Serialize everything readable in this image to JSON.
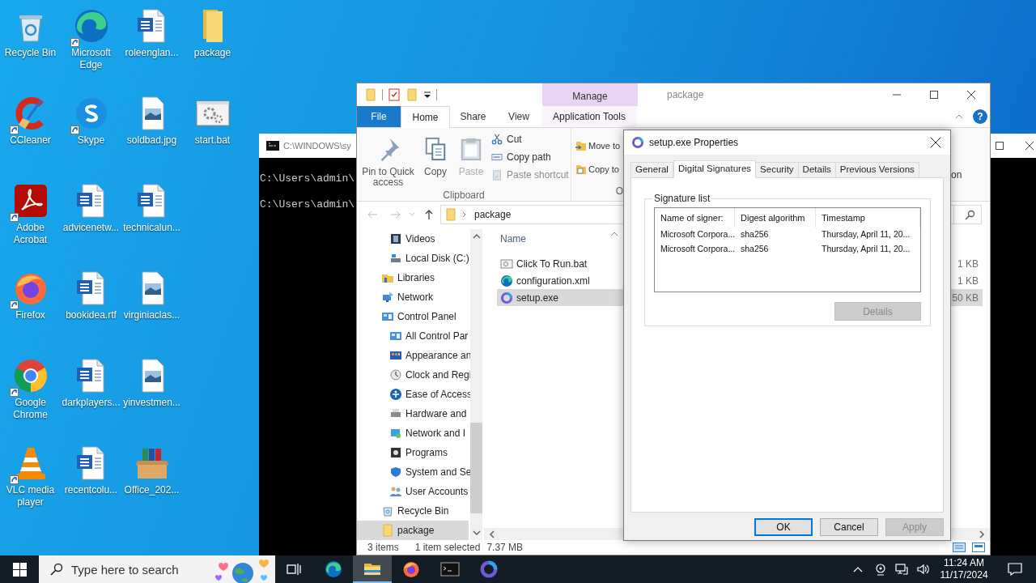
{
  "desktop_icons": [
    {
      "label": "Recycle Bin",
      "kind": "recycle",
      "shortcut": false
    },
    {
      "label": "CCleaner",
      "kind": "ccleaner",
      "shortcut": true
    },
    {
      "label": "Adobe Acrobat",
      "kind": "acrobat",
      "shortcut": true
    },
    {
      "label": "Firefox",
      "kind": "firefox",
      "shortcut": true
    },
    {
      "label": "Google Chrome",
      "kind": "chrome",
      "shortcut": true
    },
    {
      "label": "VLC media player",
      "kind": "vlc",
      "shortcut": true
    },
    {
      "label": "Microsoft Edge",
      "kind": "edge",
      "shortcut": true
    },
    {
      "label": "Skype",
      "kind": "skype",
      "shortcut": true
    },
    {
      "label": "advicenetw...",
      "kind": "word",
      "shortcut": false
    },
    {
      "label": "bookidea.rtf",
      "kind": "word",
      "shortcut": false
    },
    {
      "label": "darkplayers...",
      "kind": "word",
      "shortcut": false
    },
    {
      "label": "recentcolu...",
      "kind": "word",
      "shortcut": false
    },
    {
      "label": "roleenglan...",
      "kind": "word",
      "shortcut": false
    },
    {
      "label": "soldbad.jpg",
      "kind": "image",
      "shortcut": false
    },
    {
      "label": "technicalun...",
      "kind": "word",
      "shortcut": false
    },
    {
      "label": "virginiaclas...",
      "kind": "image",
      "shortcut": false
    },
    {
      "label": "yinvestmen...",
      "kind": "image",
      "shortcut": false
    },
    {
      "label": "Office_202...",
      "kind": "archive",
      "shortcut": false
    },
    {
      "label": "package",
      "kind": "folder",
      "shortcut": false
    },
    {
      "label": "start.bat",
      "kind": "bat",
      "shortcut": false
    }
  ],
  "console": {
    "title": "C:\\WINDOWS\\sy",
    "lines": [
      "C:\\Users\\admin\\",
      "C:\\Users\\admin\\"
    ]
  },
  "explorer": {
    "title": "package",
    "context_group": "Manage",
    "help_glyph": "?",
    "tabs": [
      {
        "label": "File",
        "kind": "file",
        "selected": false
      },
      {
        "label": "Home",
        "kind": "plain",
        "selected": true
      },
      {
        "label": "Share",
        "kind": "plain",
        "selected": false
      },
      {
        "label": "View",
        "kind": "plain",
        "selected": false
      },
      {
        "label": "Application Tools",
        "kind": "contextual",
        "selected": false
      }
    ],
    "ribbon": {
      "large_buttons": [
        {
          "label": "Pin to Quick access",
          "kind": "pin",
          "disabled": false
        },
        {
          "label": "Copy",
          "kind": "copy",
          "disabled": false
        },
        {
          "label": "Paste",
          "kind": "paste",
          "disabled": true
        }
      ],
      "small_buttons": [
        {
          "label": "Cut",
          "kind": "cut",
          "disabled": false
        },
        {
          "label": "Copy path",
          "kind": "copypath",
          "disabled": false
        },
        {
          "label": "Paste shortcut",
          "kind": "pasteshortcut",
          "disabled": true
        }
      ],
      "group_label": "Clipboard",
      "organize_buttons": [
        {
          "label": "Move to",
          "kind": "move"
        },
        {
          "label": "Copy to",
          "kind": "copyto"
        }
      ],
      "organize_label": "O",
      "right_fragment": "on"
    },
    "address": {
      "path": "package"
    },
    "nav_pane": {
      "items_continued": [
        {
          "label": "Videos",
          "kind": "videos",
          "selected": false
        },
        {
          "label": "Local Disk (C:)",
          "kind": "disk",
          "selected": false
        }
      ],
      "items": [
        {
          "label": "Libraries",
          "kind": "libraries",
          "selected": false
        },
        {
          "label": "Network",
          "kind": "network",
          "selected": false
        },
        {
          "label": "Control Panel",
          "kind": "panel",
          "selected": false,
          "children": [
            {
              "label": "All Control Par",
              "kind": "panel",
              "selected": false
            },
            {
              "label": "Appearance an",
              "kind": "appearance",
              "selected": false
            },
            {
              "label": "Clock and Regi",
              "kind": "clock",
              "selected": false
            },
            {
              "label": "Ease of Access",
              "kind": "access",
              "selected": false
            },
            {
              "label": "Hardware and",
              "kind": "hardware",
              "selected": false
            },
            {
              "label": "Network and I",
              "kind": "netpanel",
              "selected": false
            },
            {
              "label": "Programs",
              "kind": "programs",
              "selected": false
            },
            {
              "label": "System and Se",
              "kind": "security",
              "selected": false
            },
            {
              "label": "User Accounts",
              "kind": "users",
              "selected": false
            }
          ]
        },
        {
          "label": "Recycle Bin",
          "kind": "recycle",
          "selected": false
        },
        {
          "label": "package",
          "kind": "folder",
          "selected": true
        }
      ]
    },
    "file_list": {
      "column": "Name",
      "files": [
        {
          "name": "Click To Run.bat",
          "size": "1 KB",
          "kind": "bat",
          "selected": false
        },
        {
          "name": "configuration.xml",
          "size": "1 KB",
          "kind": "edge",
          "selected": false
        },
        {
          "name": "setup.exe",
          "size": "50 KB",
          "kind": "setup",
          "selected": true
        }
      ]
    },
    "status_bar": {
      "count": "3 items",
      "selection": "1 item selected",
      "size": "7.37 MB"
    }
  },
  "properties": {
    "title": "setup.exe Properties",
    "tabs": [
      {
        "label": "General",
        "selected": false
      },
      {
        "label": "Digital Signatures",
        "selected": true
      },
      {
        "label": "Security",
        "selected": false
      },
      {
        "label": "Details",
        "selected": false
      },
      {
        "label": "Previous Versions",
        "selected": false
      }
    ],
    "group": "Signature list",
    "columns": [
      "Name of signer:",
      "Digest algorithm",
      "Timestamp"
    ],
    "rows": [
      [
        "Microsoft Corpora...",
        "sha256",
        "Thursday, April 11, 20..."
      ],
      [
        "Microsoft Corpora...",
        "sha256",
        "Thursday, April 11, 20..."
      ]
    ],
    "details_button": {
      "label": "Details",
      "disabled": true
    },
    "buttons": [
      {
        "label": "OK",
        "default": true,
        "disabled": false
      },
      {
        "label": "Cancel",
        "default": false,
        "disabled": false
      },
      {
        "label": "Apply",
        "default": false,
        "disabled": true
      }
    ]
  },
  "taskbar": {
    "search_placeholder": "Type here to search",
    "apps": [
      {
        "kind": "edge",
        "active": false
      },
      {
        "kind": "explorer",
        "active": true
      },
      {
        "kind": "firefox",
        "active": false
      },
      {
        "kind": "console",
        "active": false
      },
      {
        "kind": "copilot",
        "active": false
      }
    ],
    "time": "11:24 AM",
    "date": "11/17/2024"
  }
}
